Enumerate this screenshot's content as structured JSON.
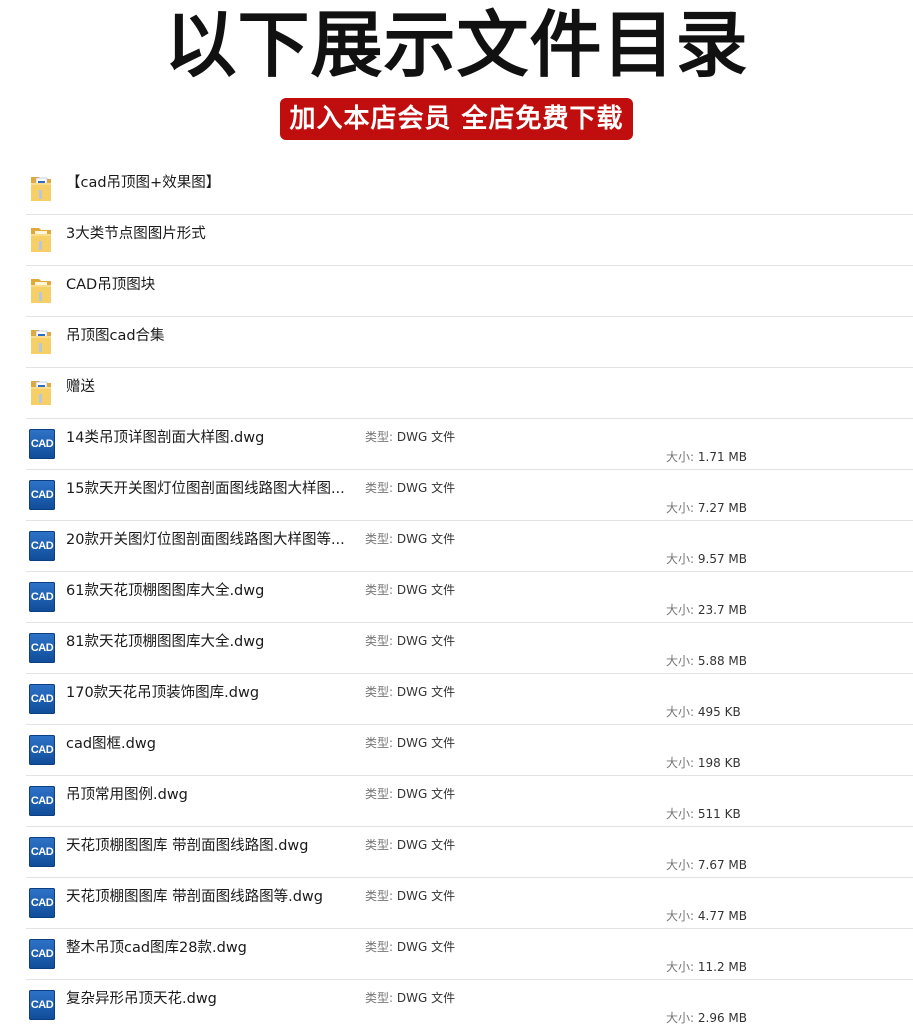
{
  "header": {
    "title": "以下展示文件目录",
    "promo": "加入本店会员 全店免费下载"
  },
  "labels": {
    "type": "类型:",
    "size": "大小:"
  },
  "folders": [
    {
      "name": "【cad吊顶图+效果图】",
      "icon": "folder-with-files-icon"
    },
    {
      "name": "3大类节点图图片形式",
      "icon": "folder-icon"
    },
    {
      "name": "CAD吊顶图块",
      "icon": "folder-icon"
    },
    {
      "name": "吊顶图cad合集",
      "icon": "folder-with-files-icon"
    },
    {
      "name": "赠送",
      "icon": "folder-with-files-icon"
    }
  ],
  "files": [
    {
      "name": "14类吊顶详图剖面大样图.dwg",
      "type": "DWG 文件",
      "size": "1.71 MB",
      "icon": "cad-file-icon"
    },
    {
      "name": "15款天开关图灯位图剖面图线路图大样图...",
      "type": "DWG 文件",
      "size": "7.27 MB",
      "icon": "cad-file-icon"
    },
    {
      "name": "20款开关图灯位图剖面图线路图大样图等...",
      "type": "DWG 文件",
      "size": "9.57 MB",
      "icon": "cad-file-icon"
    },
    {
      "name": "61款天花顶棚图图库大全.dwg",
      "type": "DWG 文件",
      "size": "23.7 MB",
      "icon": "cad-file-icon"
    },
    {
      "name": "81款天花顶棚图图库大全.dwg",
      "type": "DWG 文件",
      "size": "5.88 MB",
      "icon": "cad-file-icon"
    },
    {
      "name": "170款天花吊顶装饰图库.dwg",
      "type": "DWG 文件",
      "size": "495 KB",
      "icon": "cad-file-icon"
    },
    {
      "name": "cad图框.dwg",
      "type": "DWG 文件",
      "size": "198 KB",
      "icon": "cad-file-icon"
    },
    {
      "name": "吊顶常用图例.dwg",
      "type": "DWG 文件",
      "size": "511 KB",
      "icon": "cad-file-icon"
    },
    {
      "name": "天花顶棚图图库 带剖面图线路图.dwg",
      "type": "DWG 文件",
      "size": "7.67 MB",
      "icon": "cad-file-icon"
    },
    {
      "name": "天花顶棚图图库 带剖面图线路图等.dwg",
      "type": "DWG 文件",
      "size": "4.77 MB",
      "icon": "cad-file-icon"
    },
    {
      "name": "整木吊顶cad图库28款.dwg",
      "type": "DWG 文件",
      "size": "11.2 MB",
      "icon": "cad-file-icon"
    },
    {
      "name": "复杂异形吊顶天花.dwg",
      "type": "DWG 文件",
      "size": "2.96 MB",
      "icon": "cad-file-icon"
    }
  ],
  "icon_text": {
    "cad": "CAD"
  },
  "colors": {
    "promo_bg": "#c00d0d",
    "folder": "#f3c65a",
    "cad_icon": "#1a5fb4"
  }
}
